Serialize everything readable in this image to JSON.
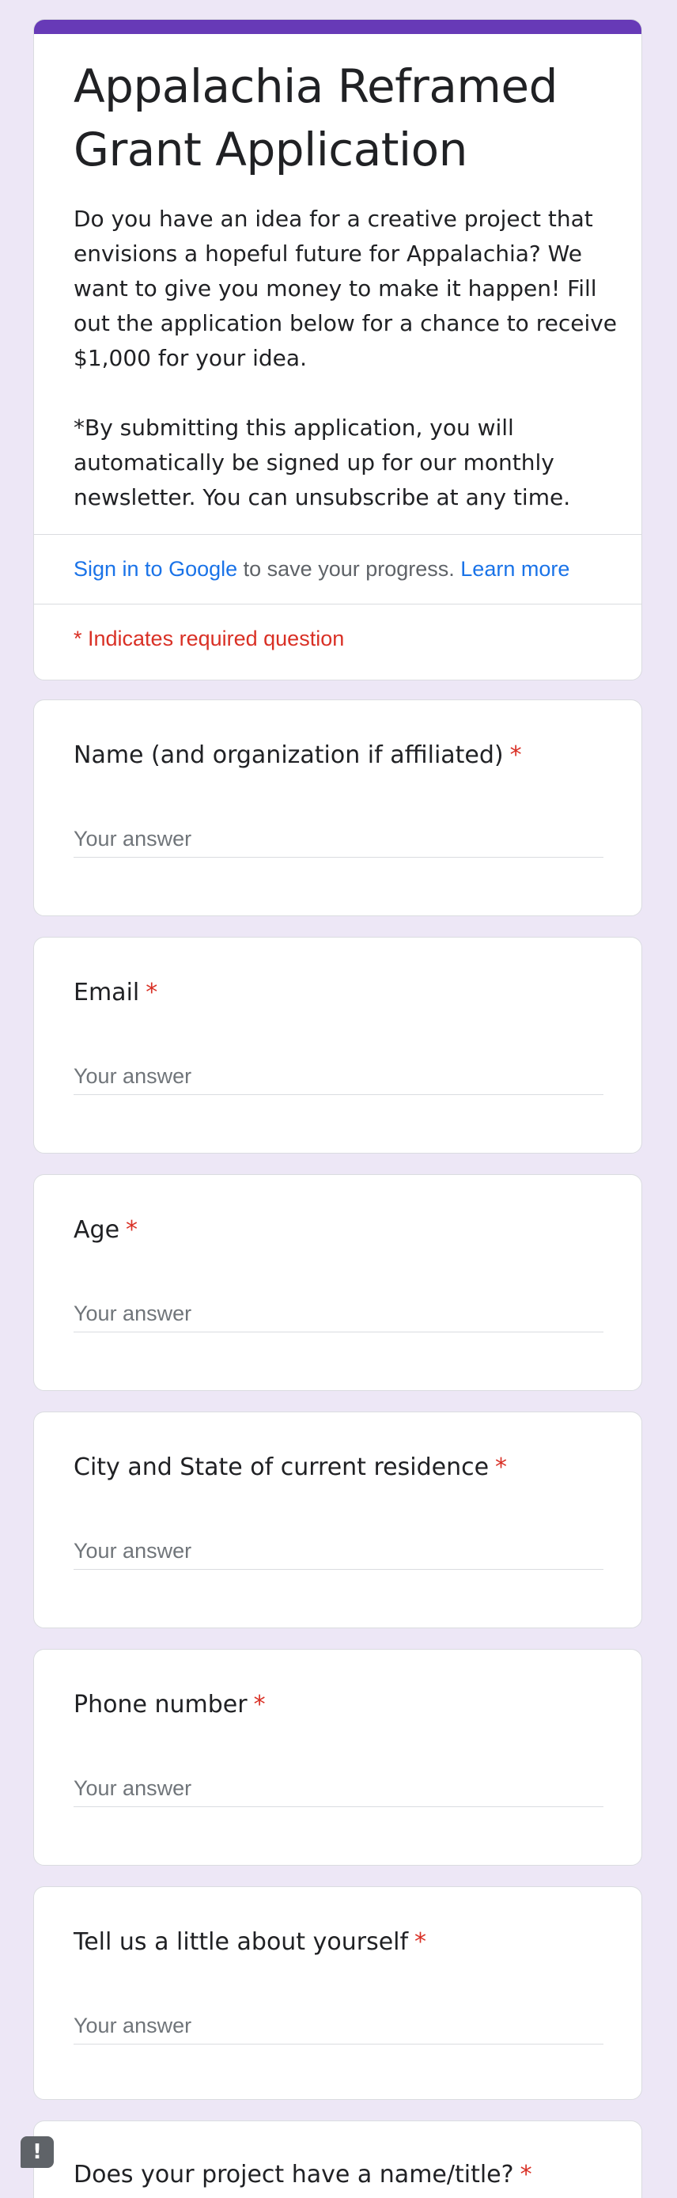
{
  "form": {
    "title": "Appalachia Reframed Grant Application",
    "description": "Do you have an idea for a creative project that envisions a hopeful future for Appalachia? We want to give you money to make it happen! Fill out the application below for a chance to receive $1,000 for your idea.\n\n*By submitting this application, you will automatically be signed up for our monthly newsletter. You can unsubscribe at any time.",
    "accent_color": "#673ab7",
    "background_color": "#ede7f6",
    "signin_link": "Sign in to Google",
    "signin_text": " to save your progress. ",
    "learn_more": "Learn more",
    "required_note": "* Indicates required question"
  },
  "questions": [
    {
      "label": "Name (and organization if affiliated)",
      "required": "*",
      "placeholder": "Your answer"
    },
    {
      "label": "Email",
      "required": "*",
      "placeholder": "Your answer"
    },
    {
      "label": "Age",
      "required": "*",
      "placeholder": "Your answer"
    },
    {
      "label": "City and State of current residence",
      "required": "*",
      "placeholder": "Your answer"
    },
    {
      "label": "Phone number",
      "required": "*",
      "placeholder": "Your answer"
    },
    {
      "label": "Tell us a little about yourself",
      "required": "*",
      "placeholder": "Your answer"
    },
    {
      "label": "Does your project have a name/title?",
      "required": "*"
    }
  ],
  "feedback": {
    "icon": "feedback-icon",
    "glyph": "!"
  }
}
